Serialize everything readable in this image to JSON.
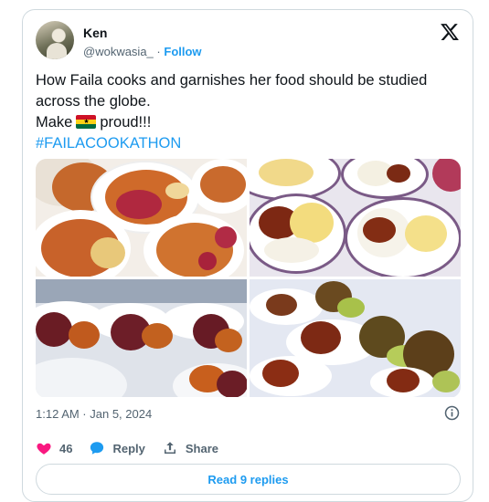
{
  "author": {
    "name": "Ken",
    "handle": "@wokwasia_",
    "separator": "·",
    "follow_label": "Follow"
  },
  "tweet": {
    "line1": "How Faila cooks and garnishes her food should be studied",
    "line2": "across the globe.",
    "line3_before": "Make",
    "line3_after": "proud!!!",
    "flag_icon": "ghana-flag-icon",
    "hashtag": "#FAILACOOKATHON"
  },
  "media": {
    "photos": [
      "jollof-plates-photo",
      "rice-stew-plates-photo",
      "rice-chicken-platters-photo",
      "rice-balls-plates-photo"
    ]
  },
  "meta": {
    "timestamp": "1:12 AM · Jan 5, 2024"
  },
  "actions": {
    "like_count": "46",
    "reply_label": "Reply",
    "share_label": "Share"
  },
  "footer": {
    "read_replies_label": "Read 9 replies"
  },
  "colors": {
    "accent": "#1d9bf0",
    "like": "#f91880",
    "text_secondary": "#536471",
    "border": "#cfd9de"
  }
}
